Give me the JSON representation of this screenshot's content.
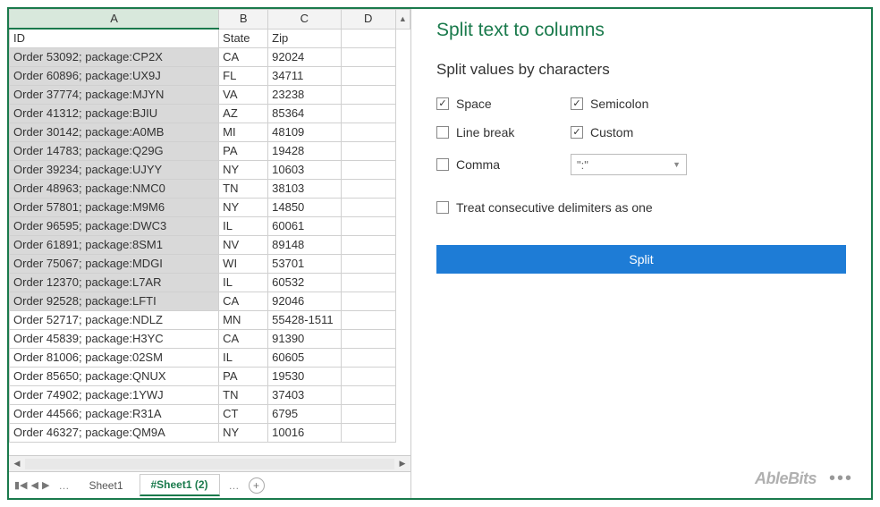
{
  "columns": [
    "A",
    "B",
    "C",
    "D"
  ],
  "headers": {
    "a": "ID",
    "b": "State",
    "c": "Zip"
  },
  "selected_col": "A",
  "rows": [
    {
      "id": "Order 53092; package:CP2X",
      "state": "CA",
      "zip": "92024"
    },
    {
      "id": "Order 60896; package:UX9J",
      "state": "FL",
      "zip": "34711"
    },
    {
      "id": "Order 37774; package:MJYN",
      "state": "VA",
      "zip": "23238"
    },
    {
      "id": "Order 41312; package:BJIU",
      "state": "AZ",
      "zip": "85364"
    },
    {
      "id": "Order 30142; package:A0MB",
      "state": "MI",
      "zip": "48109"
    },
    {
      "id": "Order 14783; package:Q29G",
      "state": "PA",
      "zip": "19428"
    },
    {
      "id": "Order 39234; package:UJYY",
      "state": "NY",
      "zip": "10603"
    },
    {
      "id": "Order 48963; package:NMC0",
      "state": "TN",
      "zip": "38103"
    },
    {
      "id": "Order 57801; package:M9M6",
      "state": "NY",
      "zip": "14850"
    },
    {
      "id": "Order 96595; package:DWC3",
      "state": "IL",
      "zip": "60061"
    },
    {
      "id": "Order 61891; package:8SM1",
      "state": "NV",
      "zip": "89148"
    },
    {
      "id": "Order 75067; package:MDGI",
      "state": "WI",
      "zip": "53701"
    },
    {
      "id": "Order 12370; package:L7AR",
      "state": "IL",
      "zip": "60532"
    },
    {
      "id": "Order 92528; package:LFTI",
      "state": "CA",
      "zip": "92046"
    },
    {
      "id": "Order 52717; package:NDLZ",
      "state": "MN",
      "zip": "55428-1511"
    },
    {
      "id": "Order 45839; package:H3YC",
      "state": "CA",
      "zip": "91390"
    },
    {
      "id": "Order 81006; package:02SM",
      "state": "IL",
      "zip": "60605"
    },
    {
      "id": "Order 85650; package:QNUX",
      "state": "PA",
      "zip": "19530"
    },
    {
      "id": "Order 74902; package:1YWJ",
      "state": "TN",
      "zip": "37403"
    },
    {
      "id": "Order 44566; package:R31A",
      "state": "CT",
      "zip": "6795"
    },
    {
      "id": "Order 46327; package:QM9A",
      "state": "NY",
      "zip": "10016"
    }
  ],
  "selection_end_index": 13,
  "tabs": {
    "sheet1": "Sheet1",
    "sheet2": "#Sheet1 (2)",
    "active": "sheet2"
  },
  "panel": {
    "title": "Split text to columns",
    "subtitle": "Split values by characters",
    "options": {
      "space": {
        "label": "Space",
        "checked": true
      },
      "semicolon": {
        "label": "Semicolon",
        "checked": true
      },
      "linebreak": {
        "label": "Line break",
        "checked": false
      },
      "custom": {
        "label": "Custom",
        "checked": true
      },
      "comma": {
        "label": "Comma",
        "checked": false
      }
    },
    "custom_value": "\":\"",
    "treat_label": "Treat consecutive delimiters as one",
    "treat_checked": false,
    "split_button": "Split"
  },
  "brand": "AbleBits"
}
